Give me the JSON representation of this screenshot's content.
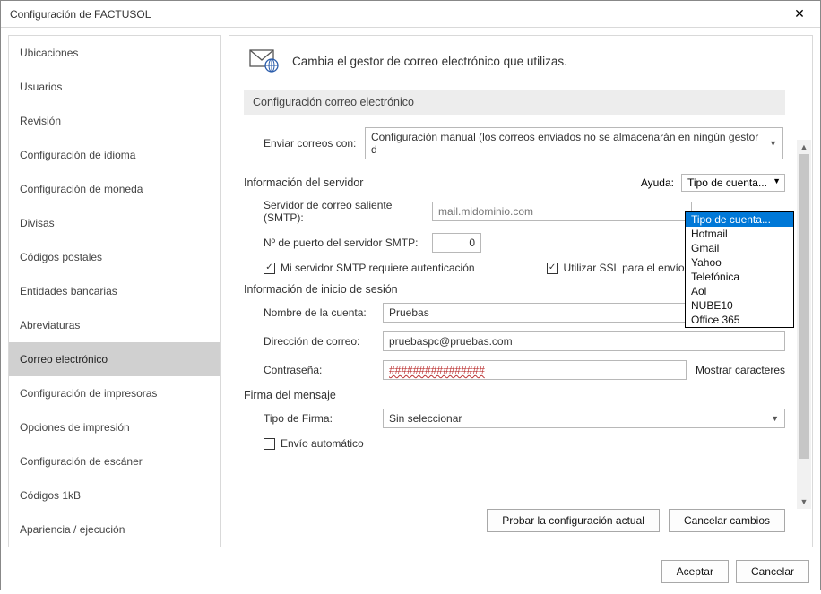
{
  "window": {
    "title": "Configuración de FACTUSOL"
  },
  "sidebar": {
    "items": [
      {
        "label": "Ubicaciones"
      },
      {
        "label": "Usuarios"
      },
      {
        "label": "Revisión"
      },
      {
        "label": "Configuración de idioma"
      },
      {
        "label": "Configuración de moneda"
      },
      {
        "label": "Divisas"
      },
      {
        "label": "Códigos postales"
      },
      {
        "label": "Entidades bancarias"
      },
      {
        "label": "Abreviaturas"
      },
      {
        "label": "Correo electrónico",
        "selected": true
      },
      {
        "label": "Configuración de impresoras"
      },
      {
        "label": "Opciones de impresión"
      },
      {
        "label": "Configuración de escáner"
      },
      {
        "label": "Códigos 1kB"
      },
      {
        "label": "Apariencia / ejecución"
      }
    ]
  },
  "page": {
    "title": "Cambia el gestor de correo electrónico que utilizas.",
    "section_header": "Configuración correo electrónico",
    "send_with_label": "Enviar correos con:",
    "send_with_value": "Configuración manual (los correos enviados no se almacenarán en ningún gestor d",
    "server_section": "Información del servidor",
    "help_label": "Ayuda:",
    "account_type": "Tipo de cuenta...",
    "smtp_label": "Servidor de correo saliente (SMTP):",
    "smtp_placeholder": "mail.midominio.com",
    "port_label": "Nº de puerto del servidor SMTP:",
    "port_value": "0",
    "smtp_auth": "Mi servidor SMTP requiere autenticación",
    "use_ssl": "Utilizar SSL para el envío de",
    "login_section": "Información de inicio de sesión",
    "account_name_label": "Nombre de la cuenta:",
    "account_name_value": "Pruebas",
    "email_label": "Dirección de correo:",
    "email_value": "pruebaspc@pruebas.com",
    "password_label": "Contraseña:",
    "password_value": "################",
    "show_chars": "Mostrar caracteres",
    "signature_section": "Firma del mensaje",
    "signature_type_label": "Tipo de Firma:",
    "signature_type_value": "Sin seleccionar",
    "auto_send": "Envío automático"
  },
  "dropdown": {
    "options": [
      "Tipo de cuenta...",
      "Hotmail",
      "Gmail",
      "Yahoo",
      "Telefónica",
      "Aol",
      "NUBE10",
      "Office 365"
    ]
  },
  "buttons": {
    "test": "Probar la configuración actual",
    "cancel_changes": "Cancelar cambios",
    "ok": "Aceptar",
    "cancel": "Cancelar"
  }
}
